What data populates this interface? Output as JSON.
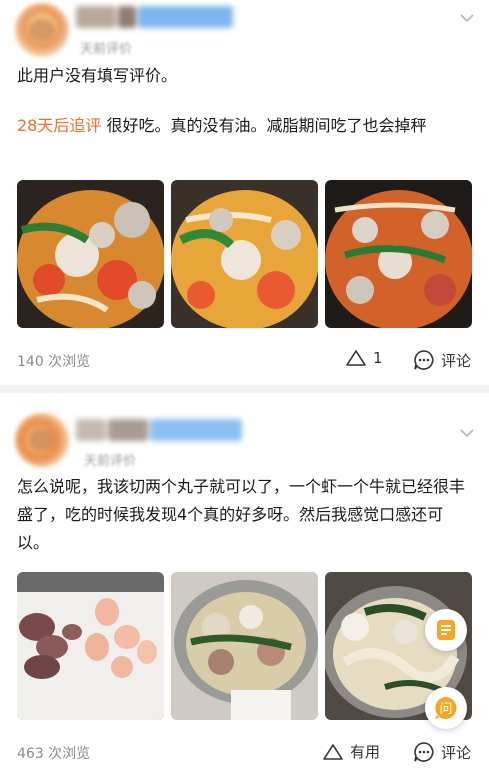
{
  "reviews": [
    {
      "meta": "天前评价",
      "line1": "此用户没有填写评价。",
      "followup_tag": "28天后追评",
      "followup_text": "很好吃。真的没有油。减脂期间吃了也会掉秤",
      "views": "140 次浏览",
      "like_count": "1",
      "comment_label": "评论"
    },
    {
      "meta": "天前评价",
      "line1": "怎么说呢，我该切两个丸子就可以了，一个虾一个牛就已经很丰盛了，吃的时候我发现4个真的好多呀。然后我感觉口感还可以。",
      "views": "463 次浏览",
      "like_label": "有用",
      "comment_label": "评论"
    }
  ],
  "icons": {
    "chevron": "chevron-down-icon",
    "like": "like-triangle-icon",
    "comment": "comment-bubble-icon",
    "orders": "orders-icon",
    "ask": "ask-question-icon"
  },
  "float_buttons": {
    "ask_glyph": "问"
  },
  "colors": {
    "highlight": "#f36c2a",
    "accent_float": "#f6a623"
  }
}
